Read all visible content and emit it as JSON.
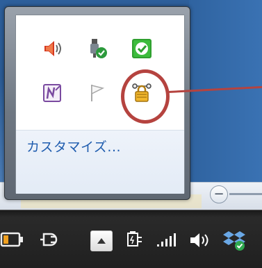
{
  "popup": {
    "customize_label": "カスタマイズ...",
    "icons": [
      {
        "name": "volume-icon"
      },
      {
        "name": "usb-safely-remove-icon"
      },
      {
        "name": "green-check-icon"
      },
      {
        "name": "onenote-icon"
      },
      {
        "name": "action-center-flag-icon"
      },
      {
        "name": "network-lock-icon"
      }
    ]
  },
  "window": {
    "zoom_text": "%"
  },
  "taskbar": {
    "items": [
      {
        "name": "battery-icon"
      },
      {
        "name": "power-plug-icon"
      },
      {
        "name": "show-hidden-icons-button"
      },
      {
        "name": "power-icon"
      },
      {
        "name": "network-signal-icon"
      },
      {
        "name": "volume-icon"
      },
      {
        "name": "dropbox-icon"
      }
    ]
  },
  "colors": {
    "highlight": "#b5433f",
    "link": "#1e5cae"
  }
}
